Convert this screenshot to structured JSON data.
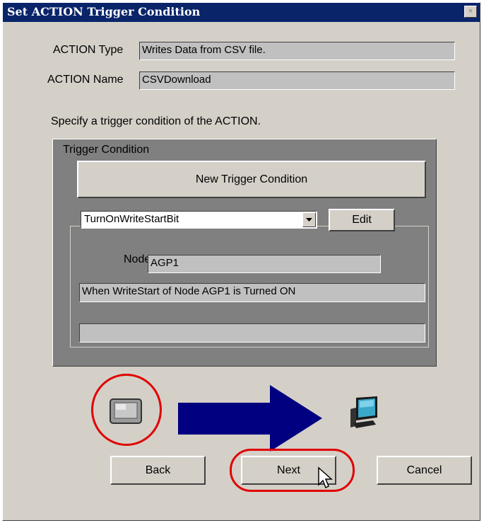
{
  "window": {
    "title": "Set ACTION Trigger Condition",
    "close_glyph": "×"
  },
  "fields": {
    "action_type_label": "ACTION Type",
    "action_type_value": "Writes Data from CSV file.",
    "action_name_label": "ACTION Name",
    "action_name_value": "CSVDownload"
  },
  "instruction": "Specify a trigger condition of the ACTION.",
  "trigger": {
    "group_label": "Trigger Condition",
    "new_button": "New Trigger Condition",
    "selected": "TurnOnWriteStartBit",
    "edit_button": "Edit",
    "node_label": "Node",
    "node_value": "AGP1",
    "description": "When WriteStart of Node AGP1 is Turned ON",
    "extra": ""
  },
  "buttons": {
    "back": "Back",
    "next": "Next",
    "cancel": "Cancel"
  },
  "colors": {
    "titlebar": "#0a246a",
    "arrow": "#000080",
    "highlight": "#e00000"
  },
  "icons": {
    "source": "display-panel-icon",
    "destination": "computer-monitor-icon",
    "cursor": "mouse-pointer-icon"
  }
}
